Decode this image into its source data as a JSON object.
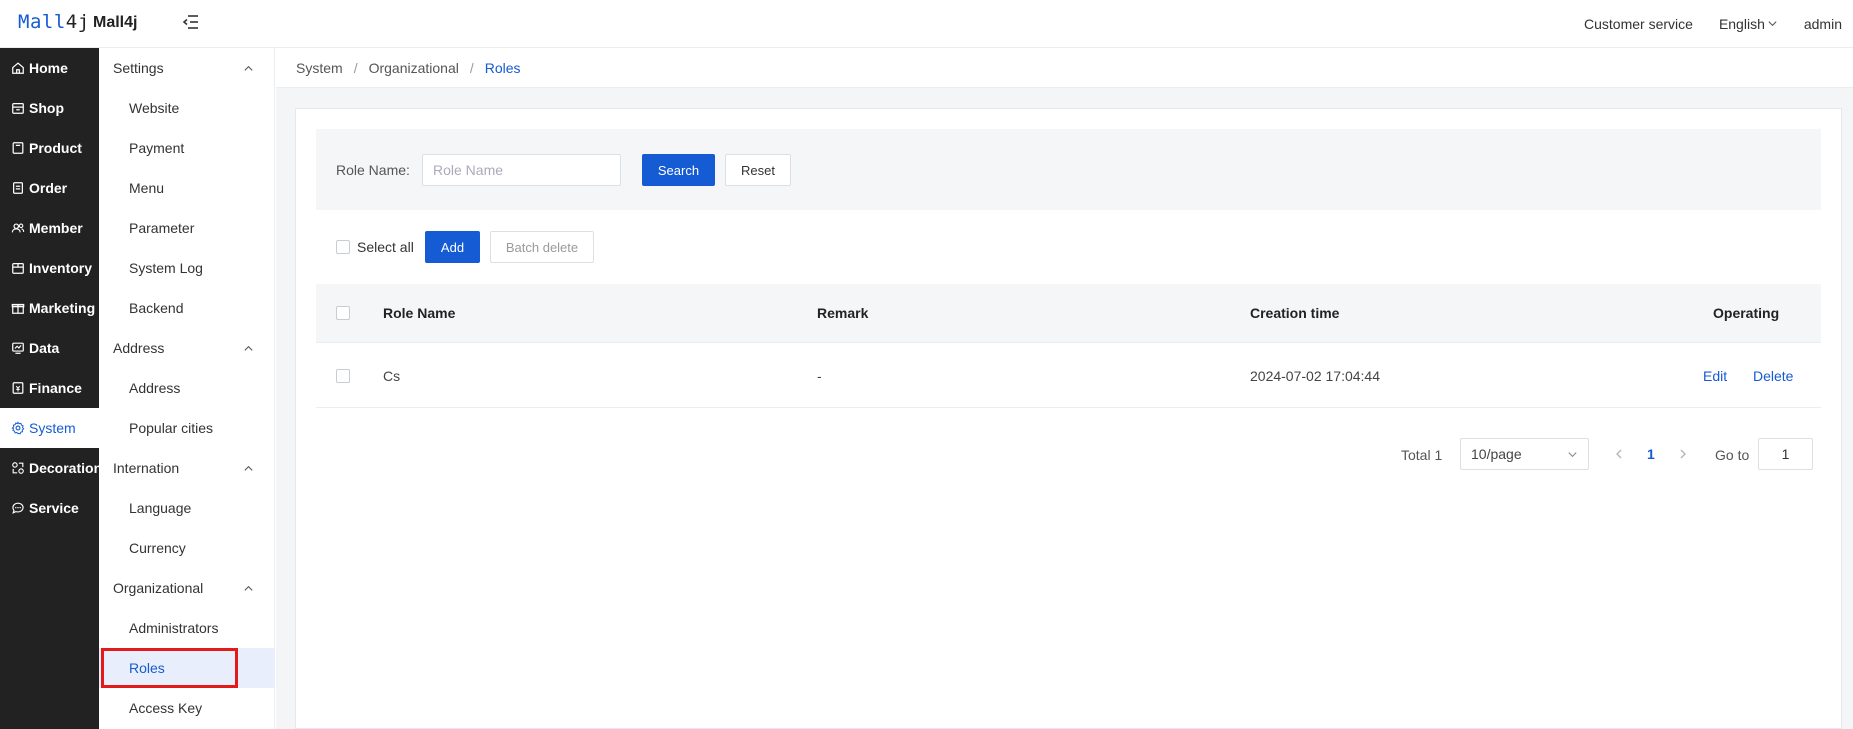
{
  "header": {
    "logo_part1": "Mall",
    "logo_part2": "4j",
    "app_name": "Mall4j",
    "customer_service": "Customer service",
    "language": "English",
    "user": "admin"
  },
  "primary_nav": [
    {
      "label": "Home",
      "icon": "home-icon"
    },
    {
      "label": "Shop",
      "icon": "shop-icon"
    },
    {
      "label": "Product",
      "icon": "product-icon"
    },
    {
      "label": "Order",
      "icon": "order-icon"
    },
    {
      "label": "Member",
      "icon": "member-icon"
    },
    {
      "label": "Inventory",
      "icon": "inventory-icon"
    },
    {
      "label": "Marketing",
      "icon": "marketing-icon"
    },
    {
      "label": "Data",
      "icon": "data-icon"
    },
    {
      "label": "Finance",
      "icon": "finance-icon"
    },
    {
      "label": "System",
      "icon": "gear-icon",
      "active": true
    },
    {
      "label": "Decoration",
      "icon": "decoration-icon"
    },
    {
      "label": "Service",
      "icon": "chat-icon"
    }
  ],
  "secondary_nav": {
    "settings": {
      "label": "Settings",
      "items": [
        "Website",
        "Payment",
        "Menu",
        "Parameter",
        "System Log",
        "Backend"
      ]
    },
    "address": {
      "label": "Address",
      "items": [
        "Address",
        "Popular cities"
      ]
    },
    "internation": {
      "label": "Internation",
      "items": [
        "Language",
        "Currency"
      ]
    },
    "organizational": {
      "label": "Organizational",
      "items": [
        "Administrators",
        "Roles",
        "Access Key"
      ]
    }
  },
  "breadcrumb": {
    "level1": "System",
    "level2": "Organizational",
    "current": "Roles",
    "separator": "/"
  },
  "search": {
    "label": "Role Name:",
    "placeholder": "Role Name",
    "search_button": "Search",
    "reset_button": "Reset"
  },
  "actions": {
    "select_all": "Select all",
    "add": "Add",
    "batch_delete": "Batch delete"
  },
  "table": {
    "columns": [
      "Role Name",
      "Remark",
      "Creation time",
      "Operating"
    ],
    "rows": [
      {
        "role_name": "Cs",
        "remark": "-",
        "creation_time": "2024-07-02 17:04:44",
        "edit": "Edit",
        "delete": "Delete"
      }
    ]
  },
  "pagination": {
    "total": "Total 1",
    "page_size": "10/page",
    "current_page": "1",
    "goto_label": "Go to",
    "goto_value": "1"
  },
  "colors": {
    "brand": "#155bd4",
    "sidebar_bg": "#222222",
    "highlight": "#e21a1a"
  }
}
